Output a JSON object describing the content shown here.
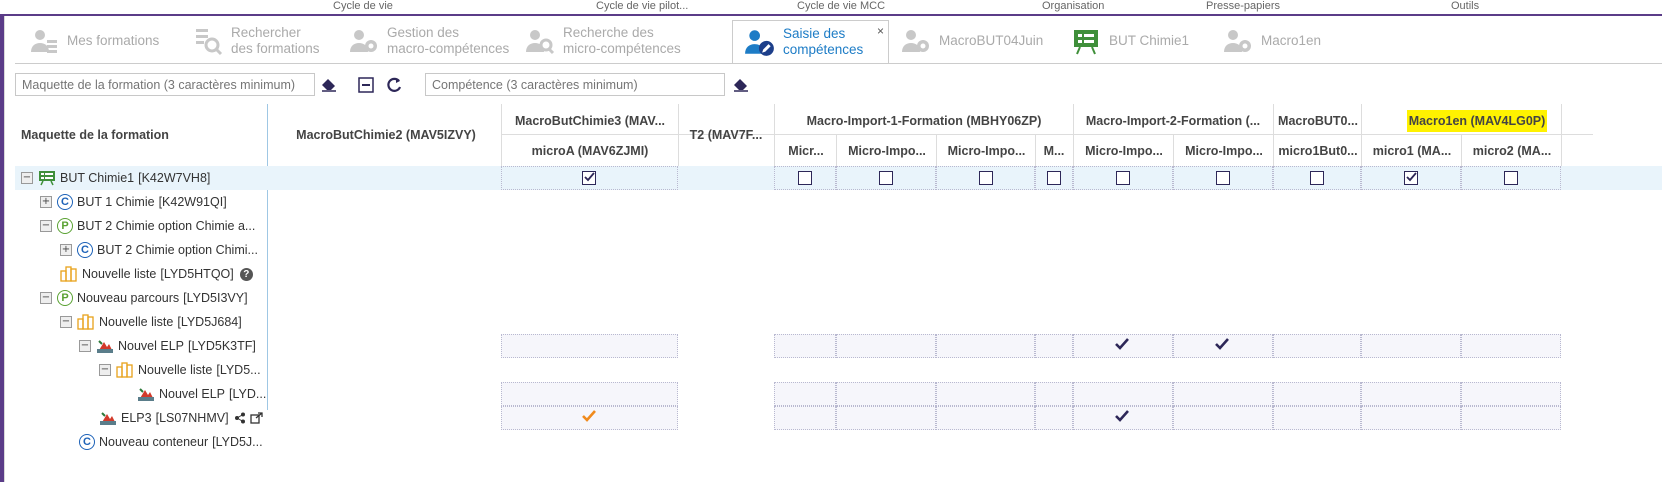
{
  "top_menu": [
    "Cycle de vie",
    "Cycle de vie pilot...",
    "Cycle de vie MCC",
    "Organisation",
    "Presse-papiers",
    "Outils"
  ],
  "tabs": [
    {
      "label_line1": "Mes formations",
      "label_line2": "",
      "icon": "user-list-icon",
      "active": false
    },
    {
      "label_line1": "Rechercher",
      "label_line2": "des formations",
      "icon": "search-list-icon",
      "active": false
    },
    {
      "label_line1": "Gestion des",
      "label_line2": "macro-compétences",
      "icon": "users-gear-icon",
      "active": false
    },
    {
      "label_line1": "Recherche des",
      "label_line2": "micro-compétences",
      "icon": "users-search-icon",
      "active": false
    },
    {
      "label_line1": "Saisie des",
      "label_line2": "compétences",
      "icon": "users-edit-icon",
      "active": true
    },
    {
      "label_line1": "MacroBUT04Juin",
      "label_line2": "",
      "icon": "users-gear-icon",
      "active": false
    },
    {
      "label_line1": "BUT Chimie1",
      "label_line2": "",
      "icon": "board-icon",
      "active": false
    },
    {
      "label_line1": "Macro1en",
      "label_line2": "",
      "icon": "users-gear-icon",
      "active": false
    }
  ],
  "tab_close": "×",
  "toolbar": {
    "formation_placeholder": "Maquette de la formation (3 caractères minimum)",
    "competence_placeholder": "Compétence (3 caractères minimum)"
  },
  "grid": {
    "tree_header": "Maquette de la formation",
    "macro_headers": [
      "MacroButChimie2 (MAV5IZVY)",
      "MacroButChimie3 (MAV...",
      "T2 (MAV7F...",
      "Macro-Import-1-Formation (MBHY06ZP)",
      "Macro-Import-2-Formation (...",
      "MacroBUT0...",
      "Macro1en (MAV4LG0P)"
    ],
    "micro_headers": [
      "microA (MAV6ZJMI)",
      "Micr...",
      "Micro-Impo...",
      "Micro-Impo...",
      "M...",
      "Micro-Impo...",
      "Micro-Impo...",
      "micro1But0...",
      "micro1 (MA...",
      "micro2 (MA..."
    ],
    "tree": [
      {
        "label": "BUT Chimie1",
        "code": "[K42W7VH8]",
        "expander": "−",
        "badge": "",
        "icon": "board-icon"
      },
      {
        "label": "BUT 1 Chimie",
        "code": "[K42W91QI]",
        "expander": "+",
        "badge": "C",
        "icon": ""
      },
      {
        "label": "BUT 2 Chimie option Chimie a...",
        "code": "",
        "expander": "−",
        "badge": "P",
        "icon": ""
      },
      {
        "label": "BUT 2 Chimie option Chimi...",
        "code": "",
        "expander": "+",
        "badge": "C",
        "icon": ""
      },
      {
        "label": "Nouvelle liste",
        "code": "[LYD5HTQO]",
        "expander": "",
        "badge": "",
        "icon": "list-icon"
      },
      {
        "label": "Nouveau parcours",
        "code": "[LYD5I3VY]",
        "expander": "−",
        "badge": "P",
        "icon": ""
      },
      {
        "label": "Nouvelle liste",
        "code": "[LYD5J684]",
        "expander": "−",
        "badge": "",
        "icon": "list-icon"
      },
      {
        "label": "Nouvel ELP",
        "code": "[LYD5K3TF]",
        "expander": "−",
        "badge": "",
        "icon": "elp-icon"
      },
      {
        "label": "Nouvelle liste",
        "code": "[LYD5...",
        "expander": "−",
        "badge": "",
        "icon": "list-icon"
      },
      {
        "label": "Nouvel ELP",
        "code": "[LYD...",
        "expander": "",
        "badge": "",
        "icon": "elp-icon"
      },
      {
        "label": "ELP3",
        "code": "[LS07NHMV]",
        "expander": "",
        "badge": "",
        "icon": "elp-icon"
      },
      {
        "label": "Nouveau conteneur",
        "code": "[LYD5J...",
        "expander": "",
        "badge": "C",
        "icon": ""
      }
    ]
  },
  "colors": {
    "accent_purple": "#5b3c88",
    "tab_active": "#1d7cc6",
    "check_dark": "#2d2758",
    "check_orange": "#f08a1c",
    "highlight": "#fff200"
  }
}
